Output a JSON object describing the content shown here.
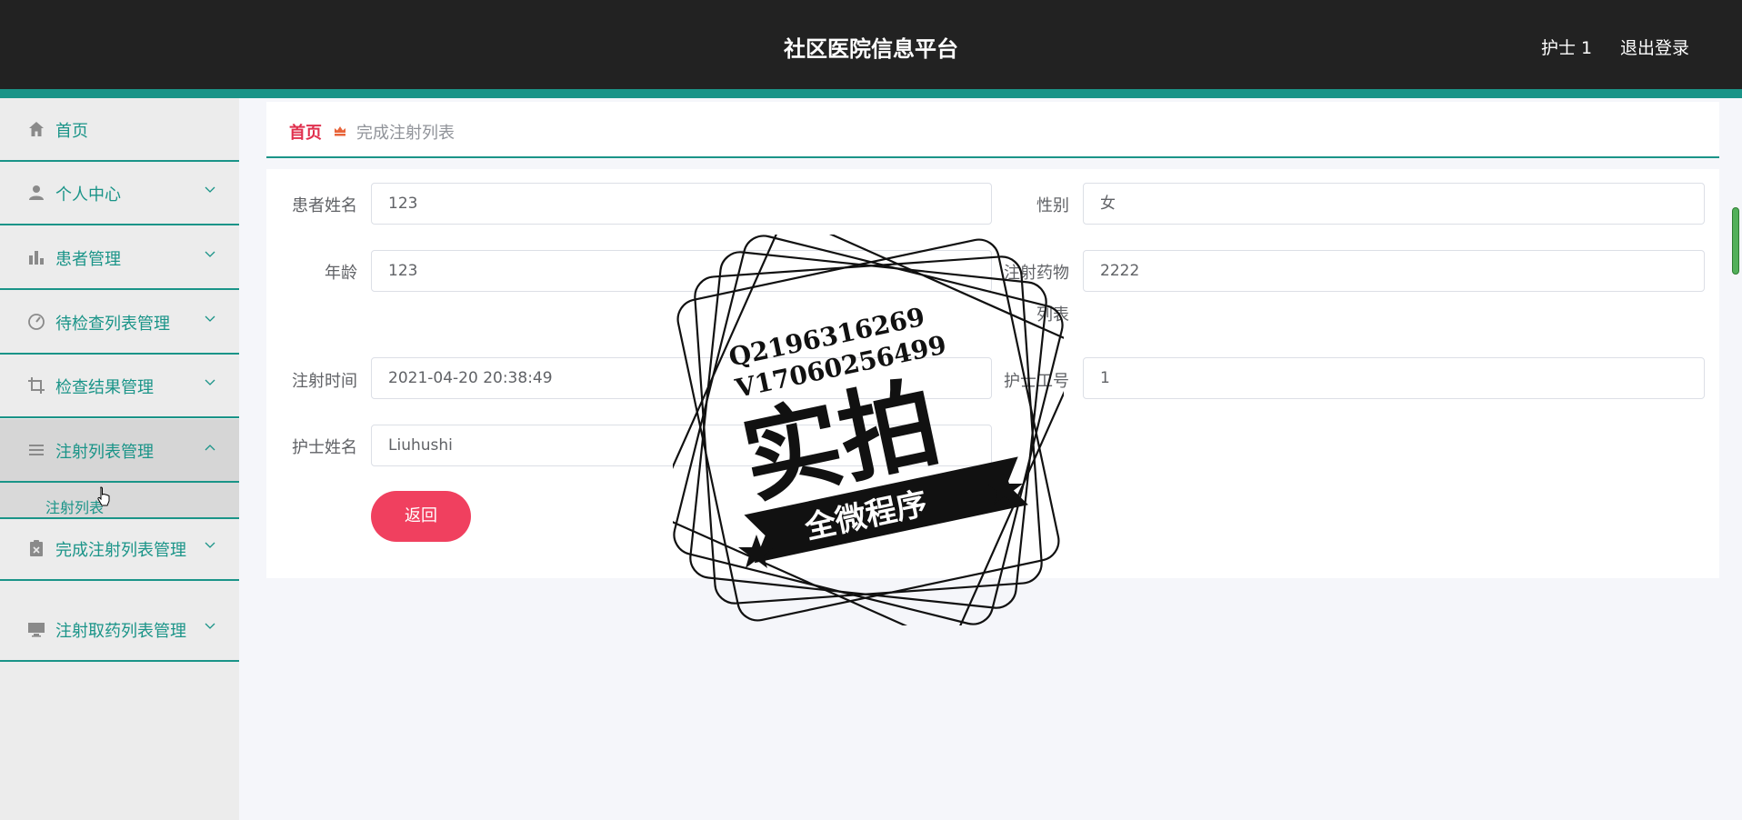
{
  "header": {
    "title": "社区医院信息平台",
    "user": "护士 1",
    "logout": "退出登录"
  },
  "sidebar": {
    "items": [
      {
        "label": "首页",
        "icon": "home-icon"
      },
      {
        "label": "个人中心",
        "icon": "user-icon"
      },
      {
        "label": "患者管理",
        "icon": "bar-chart-icon"
      },
      {
        "label": "待检查列表管理",
        "icon": "gauge-icon"
      },
      {
        "label": "检查结果管理",
        "icon": "crop-icon"
      },
      {
        "label": "注射列表管理",
        "icon": "list-icon"
      },
      {
        "label": "完成注射列表管理",
        "icon": "clipboard-x-icon"
      },
      {
        "label": "注射取药列表管理",
        "icon": "monitor-icon"
      }
    ],
    "submenu": "注射列表"
  },
  "breadcrumb": {
    "home": "首页",
    "current": "完成注射列表"
  },
  "form": {
    "patient_name_label": "患者姓名",
    "patient_name": "123",
    "gender_label": "性别",
    "gender": "女",
    "age_label": "年龄",
    "age": "123",
    "drug_list_label_1": "注射药物",
    "drug_list_label_2": "列表",
    "drug_list": "2222",
    "injection_time_label": "注射时间",
    "injection_time": "2021-04-20 20:38:49",
    "nurse_id_label": "护士工号",
    "nurse_id": "1",
    "nurse_name_label": "护士姓名",
    "nurse_name": "Liuhushi",
    "back_button": "返回"
  },
  "watermark": {
    "line1": "Q2196316269",
    "line2": "V17060256499",
    "main": "实拍",
    "banner": "全微程序"
  },
  "colors": {
    "header_bg": "#222222",
    "accent": "#1a9488",
    "primary_button": "#f0405f",
    "breadcrumb_home": "#e0304e"
  }
}
